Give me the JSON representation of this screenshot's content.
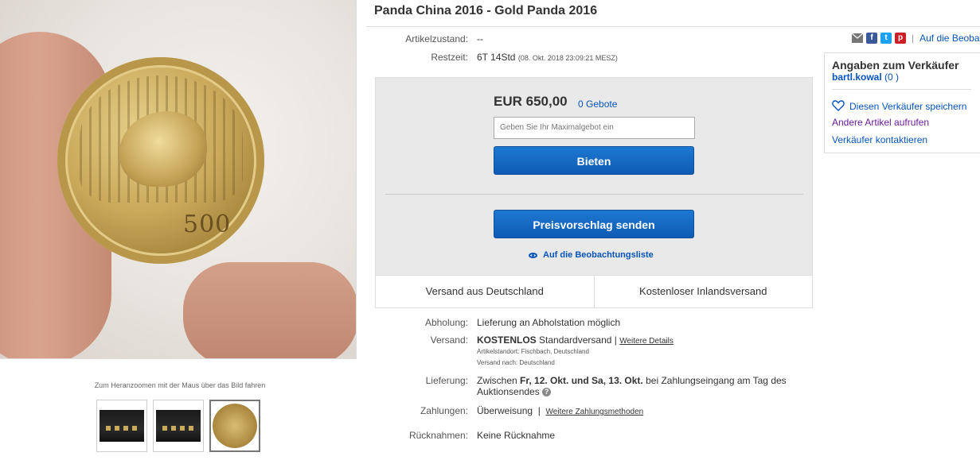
{
  "title": "Panda China 2016 -  Gold Panda 2016",
  "image": {
    "coin_value": "500",
    "zoom_hint": "Zum Heranzoomen mit der Maus über das Bild fahren"
  },
  "details": {
    "condition_label": "Artikelzustand:",
    "condition_value": "--",
    "time_label": "Restzeit:",
    "time_value": "6T 14Std",
    "time_end": "(08. Okt. 2018   23:09:21 MESZ)"
  },
  "bid": {
    "price": "EUR 650,00",
    "bids": "0 Gebote",
    "max_bid_placeholder": "Geben Sie Ihr Maximalgebot ein",
    "bid_button": "Bieten",
    "offer_button": "Preisvorschlag senden",
    "watchlist": "Auf die Beobachtungsliste",
    "ship_from": "Versand aus Deutschland",
    "free_domestic": "Kostenloser Inlandsversand"
  },
  "shipping": {
    "pickup_label": "Abholung:",
    "pickup_value": "Lieferung an Abholstation möglich",
    "ship_label": "Versand:",
    "ship_free": "KOSTENLOS",
    "ship_type": "Standardversand |",
    "ship_more": "Weitere Details",
    "location": "Artikelstandort:  Fischbach, Deutschland",
    "ships_to": "Versand nach:  Deutschland",
    "delivery_label": "Lieferung:",
    "delivery_pre": "Zwischen",
    "delivery_dates": "Fr, 12. Okt. und Sa, 13. Okt.",
    "delivery_post": "bei Zahlungseingang am Tag des",
    "delivery_line2": "Auktionsendes",
    "payment_label": "Zahlungen:",
    "payment_value": "Überweisung",
    "payment_more": "Weitere Zahlungsmethoden",
    "returns_label": "Rücknahmen:",
    "returns_value": "Keine Rücknahme"
  },
  "seller": {
    "heading": "Angaben zum Verkäufer",
    "name": "bartl.kowal",
    "rating": "(0 )",
    "save": "Diesen Verkäufer speichern",
    "other_items": "Andere Artikel aufrufen",
    "contact": "Verkäufer kontaktieren"
  },
  "share": {
    "watch_link": "Auf die Beoba"
  },
  "colors": {
    "link": "#0654ba",
    "button": "#1566c4",
    "facebook": "#3b5998",
    "twitter": "#1da1f2",
    "pinterest": "#cb2027"
  }
}
